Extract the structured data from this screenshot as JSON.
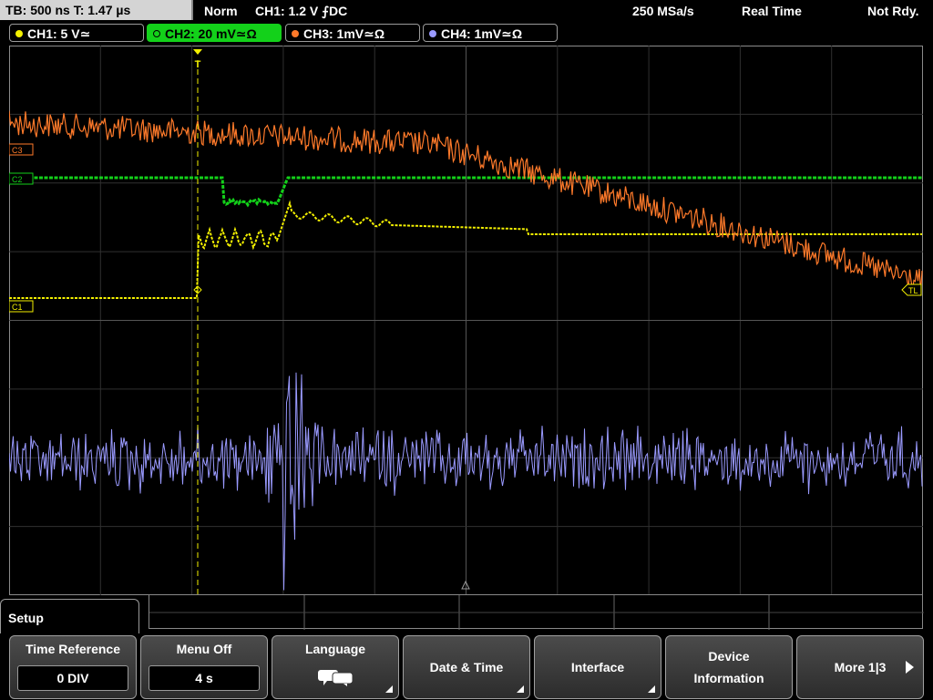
{
  "status": {
    "timebase": "TB: 500 ns   T: 1.47 µs",
    "mode": "Norm",
    "trigger": "CH1: 1.2 V ⨍DC",
    "sample_rate": "250 MSa/s",
    "acq": "Real Time",
    "state": "Not Rdy."
  },
  "channels": [
    {
      "label": "CH1: 5 V≃",
      "color": "#f3f000"
    },
    {
      "label": "CH2: 20 mV≃Ω",
      "color": "#13d11a"
    },
    {
      "label": "CH3: 1mV≃Ω",
      "color": "#ff7a2a"
    },
    {
      "label": "CH4: 1mV≃Ω",
      "color": "#9a9aff"
    }
  ],
  "markers": {
    "c1": "C1",
    "c2": "C2",
    "c3": "C3",
    "tl": "TL"
  },
  "menu": {
    "title": "Setup",
    "softkeys": [
      {
        "label": "Time Reference",
        "value": "0 DIV"
      },
      {
        "label": "Menu Off",
        "value": "4 s"
      },
      {
        "label": "Language",
        "icon": "speech-bubble-icon"
      },
      {
        "label": "Date & Time"
      },
      {
        "label": "Interface"
      },
      {
        "label_line1": "Device",
        "label_line2": "Information"
      },
      {
        "label": "More 1|3",
        "icon": "right-arrow-icon"
      }
    ]
  },
  "colors": {
    "ch1": "#f3f000",
    "ch2": "#13d11a",
    "ch3": "#ff7a2a",
    "ch4": "#9a9aff",
    "grid": "#3a3a3a"
  }
}
